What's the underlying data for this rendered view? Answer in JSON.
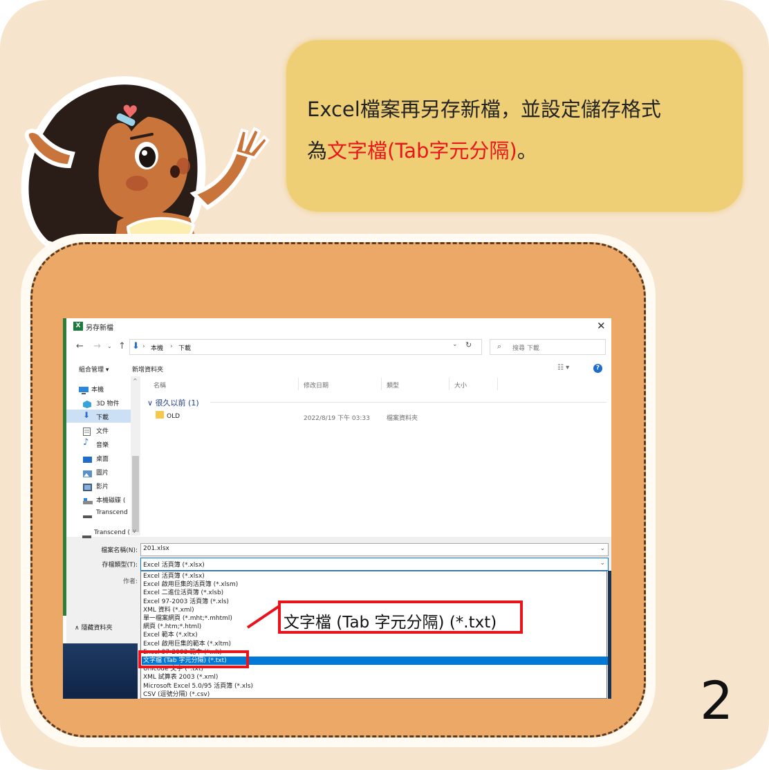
{
  "instruction": {
    "line1": "Excel檔案再另存新檔，並設定儲存格式",
    "line2_prefix": "為",
    "line2_highlight": "文字檔(Tab字元分隔)",
    "line2_suffix": "。"
  },
  "step_number": "2",
  "dialog": {
    "title": "另存新檔",
    "app_icon": "excel-icon",
    "close": "✕",
    "breadcrumb": [
      "本機",
      "下載"
    ],
    "search_placeholder": "搜尋 下載",
    "toolbar": {
      "organize": "組合管理 ▾",
      "new_folder": "新增資料夾"
    },
    "sidebar": [
      {
        "icon": "pc-icon",
        "label": "本機"
      },
      {
        "icon": "3d-objects-icon",
        "label": "3D 物件"
      },
      {
        "icon": "download-icon",
        "label": "下載",
        "selected": true
      },
      {
        "icon": "document-icon",
        "label": "文件"
      },
      {
        "icon": "music-icon",
        "label": "音樂"
      },
      {
        "icon": "desktop-icon",
        "label": "桌面"
      },
      {
        "icon": "pictures-icon",
        "label": "圖片"
      },
      {
        "icon": "video-icon",
        "label": "影片"
      },
      {
        "icon": "local-disk-icon",
        "label": "本機磁碟 ("
      },
      {
        "icon": "drive-icon",
        "label": "Transcend"
      }
    ],
    "sidebar_drive2": "Transcend (",
    "columns": [
      "名稱",
      "修改日期",
      "類型",
      "大小"
    ],
    "group": "很久以前 (1)",
    "files": [
      {
        "name": "OLD",
        "date": "2022/8/19 下午 03:33",
        "type": "檔案資料夾"
      }
    ],
    "filename_label": "檔案名稱(N):",
    "filename_value": "201.xlsx",
    "filetype_label": "存檔類型(T):",
    "filetype_value": "Excel 活頁簿 (*.xlsx)",
    "author_label": "作者:",
    "hide_folders": "隱藏資料夾",
    "type_options": [
      "Excel 活頁簿 (*.xlsx)",
      "Excel 啟用巨集的活頁簿 (*.xlsm)",
      "Excel 二進位活頁簿 (*.xlsb)",
      "Excel 97-2003 活頁簿 (*.xls)",
      "XML 資料 (*.xml)",
      "單一檔案網頁 (*.mht;*.mhtml)",
      "網頁 (*.htm;*.html)",
      "Excel 範本 (*.xltx)",
      "Excel 啟用巨集的範本 (*.xltm)",
      "Excel 97-2003 範本 (*.xlt)",
      "文字檔 (Tab 字元分隔) (*.txt)",
      "Unicode 文字 (*.txt)",
      "XML 試算表 2003 (*.xml)",
      "Microsoft Excel 5.0/95 活頁簿 (*.xls)",
      "CSV (逗號分隔) (*.csv)"
    ],
    "selected_option_index": 10
  },
  "callout": "文字檔 (Tab 字元分隔) (*.txt)",
  "colors": {
    "accent_red": "#e8151b",
    "bubble": "#efcf76",
    "frame": "#eba866",
    "selection": "#0078d7"
  }
}
